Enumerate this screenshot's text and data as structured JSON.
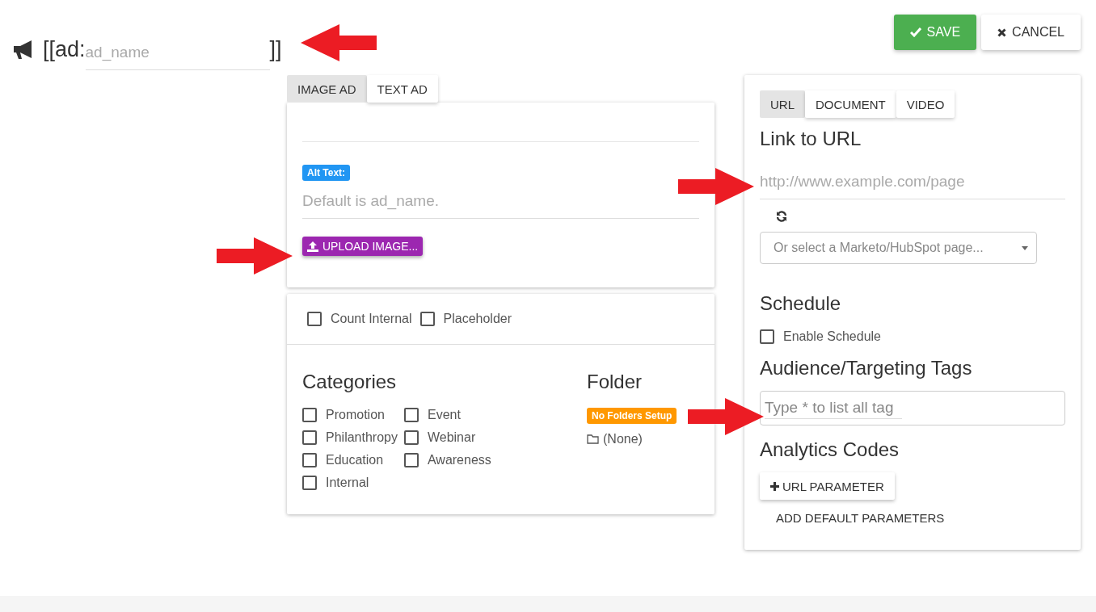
{
  "header": {
    "prefix": "[[ad:",
    "name_placeholder": "ad_name",
    "suffix": "]]"
  },
  "actions": [
    {
      "kind": "save",
      "label": "SAVE"
    },
    {
      "kind": "cancel",
      "label": "CANCEL"
    }
  ],
  "ad_tabs": [
    {
      "label": "IMAGE AD",
      "selected": true
    },
    {
      "label": "TEXT AD",
      "selected": false
    }
  ],
  "image_ad": {
    "alt_badge": "Alt Text:",
    "alt_placeholder": "Default is ad_name.",
    "upload_button": "UPLOAD IMAGE..."
  },
  "options": [
    {
      "label": "Count Internal",
      "checked": false
    },
    {
      "label": "Placeholder",
      "checked": false
    }
  ],
  "categories": {
    "title": "Categories",
    "items": [
      {
        "label": "Promotion",
        "checked": false
      },
      {
        "label": "Event",
        "checked": false
      },
      {
        "label": "Philanthropy",
        "checked": false
      },
      {
        "label": "Webinar",
        "checked": false
      },
      {
        "label": "Education",
        "checked": false
      },
      {
        "label": "Awareness",
        "checked": false
      },
      {
        "label": "Internal",
        "checked": false
      }
    ]
  },
  "folder": {
    "title": "Folder",
    "badge": "No Folders Setup",
    "current": "(None)"
  },
  "link_tabs": [
    {
      "label": "URL",
      "selected": true
    },
    {
      "label": "DOCUMENT",
      "selected": false
    },
    {
      "label": "VIDEO",
      "selected": false
    }
  ],
  "link": {
    "title": "Link to URL",
    "url_placeholder": "http://www.example.com/page",
    "select_placeholder": "Or select a Marketo/HubSpot page..."
  },
  "schedule": {
    "title": "Schedule",
    "label": "Enable Schedule",
    "checked": false
  },
  "tags": {
    "title": "Audience/Targeting Tags",
    "placeholder": "Type * to list all tag"
  },
  "analytics": {
    "title": "Analytics Codes",
    "add_button": "URL PARAMETER",
    "default_button": "ADD DEFAULT PARAMETERS"
  }
}
